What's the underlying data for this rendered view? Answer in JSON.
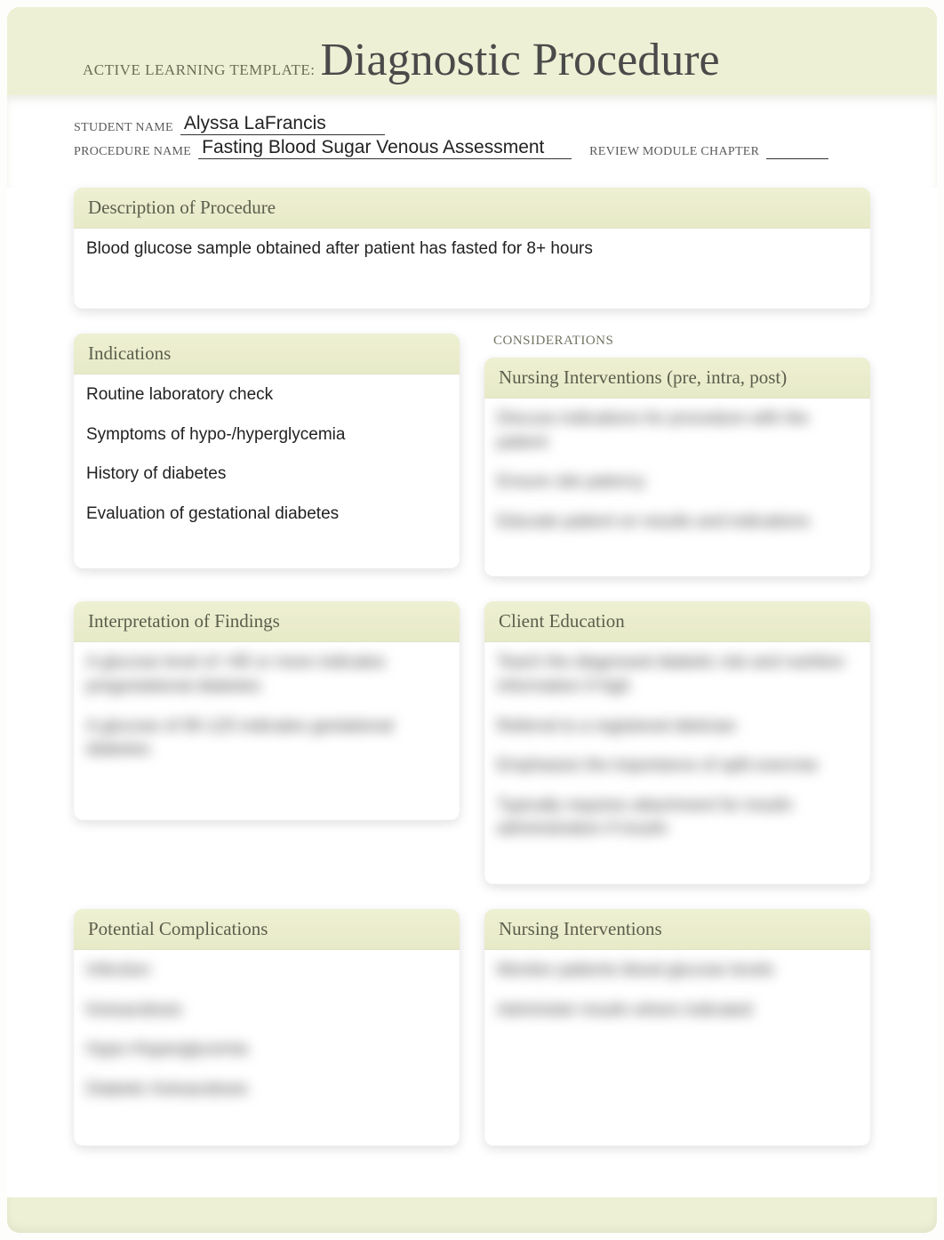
{
  "header": {
    "prefix": "ACTIVE LEARNING TEMPLATE:",
    "title": "Diagnostic Procedure"
  },
  "meta": {
    "student_label": "STUDENT NAME",
    "student_value": "Alyssa LaFrancis",
    "procedure_label": "PROCEDURE NAME",
    "procedure_value": "Fasting Blood Sugar Venous Assessment",
    "chapter_label": "REVIEW MODULE CHAPTER",
    "chapter_value": ""
  },
  "description": {
    "title": "Description of Procedure",
    "text": "Blood glucose sample obtained after patient has fasted for 8+ hours"
  },
  "indications": {
    "title": "Indications",
    "items": [
      "Routine laboratory check",
      "Symptoms of hypo-/hyperglycemia",
      "History of diabetes",
      "Evaluation of gestational diabetes"
    ]
  },
  "considerations_label": "CONSIDERATIONS",
  "nursing_pre": {
    "title": "Nursing Interventions (pre, intra, post)",
    "items": [
      "Discuss indications for procedure with the patient",
      "Ensure site patency",
      "Educate patient on results and indications"
    ]
  },
  "interpretation": {
    "title": "Interpretation of Findings",
    "items": [
      "A glucose level of >95 or more indicates pregestational diabetes",
      "A glucose of 95-125 indicates gestational diabetes"
    ]
  },
  "education": {
    "title": "Client Education",
    "items": [
      "Teach the diagnosed diabetic risk and nutrition information if high",
      "Referral to a registered dietician",
      "Emphasize the importance of split exercise",
      "Typically requires attachment for insulin administration if insulin"
    ]
  },
  "complications": {
    "title": "Potential Complications",
    "items": [
      "Infection",
      "Ketoacidosis",
      "Hypo-/Hyperglycemia",
      "Diabetic Ketoacidosis"
    ]
  },
  "nursing2": {
    "title": "Nursing Interventions",
    "items": [
      "Monitor patients blood glucose levels",
      "Administer insulin where indicated"
    ]
  }
}
